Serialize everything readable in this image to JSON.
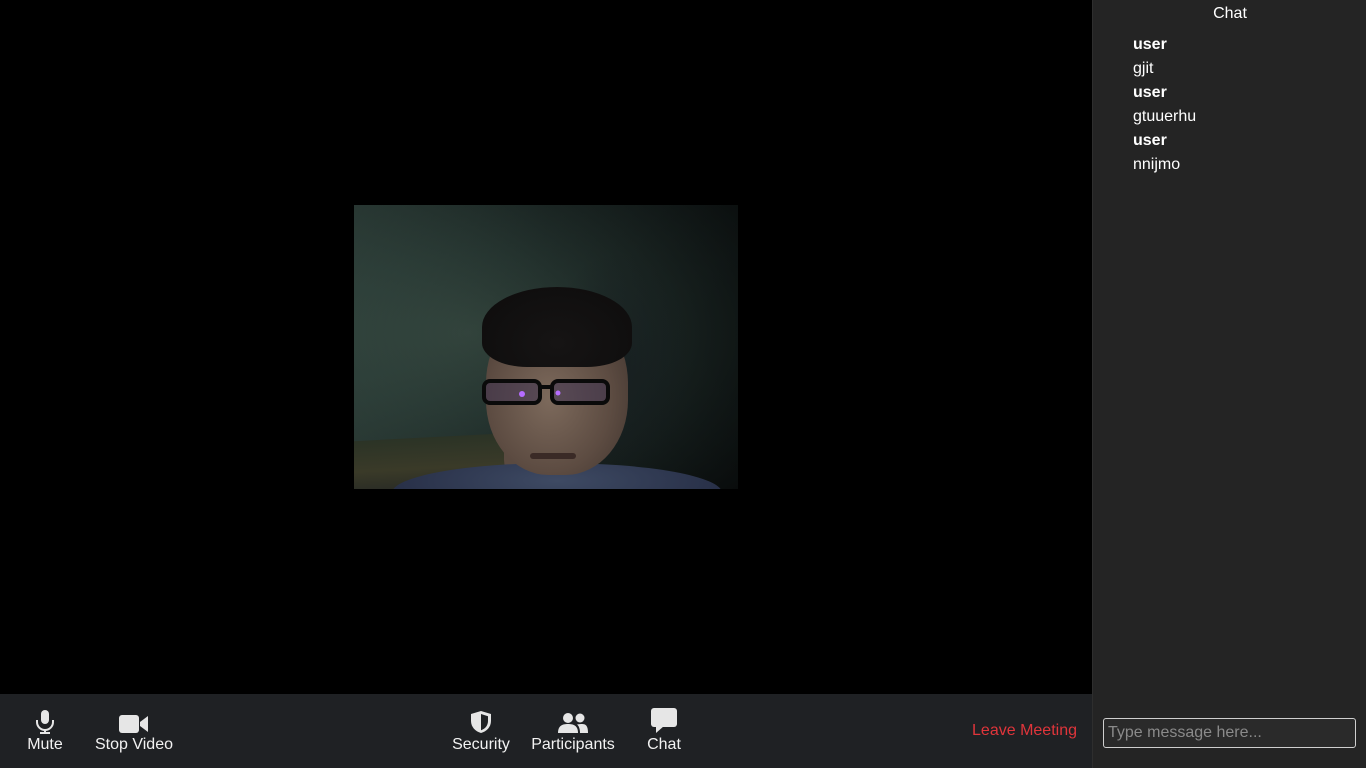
{
  "toolbar": {
    "mute_label": "Mute",
    "stop_video_label": "Stop Video",
    "security_label": "Security",
    "participants_label": "Participants",
    "chat_label": "Chat",
    "leave_label": "Leave Meeting"
  },
  "chat": {
    "title": "Chat",
    "messages": [
      {
        "user": "user",
        "text": "gjit"
      },
      {
        "user": "user",
        "text": "gtuuerhu"
      },
      {
        "user": "user",
        "text": "nnijmo"
      }
    ],
    "input_placeholder": "Type message here..."
  },
  "colors": {
    "toolbar_bg": "#1f2124",
    "chat_bg": "#242424",
    "leave_red": "#e0353b",
    "icon_color": "#e6e6e6"
  },
  "icons": {
    "mute": "microphone-icon",
    "stop_video": "video-camera-icon",
    "security": "shield-icon",
    "participants": "participants-icon",
    "chat": "chat-bubble-icon"
  }
}
